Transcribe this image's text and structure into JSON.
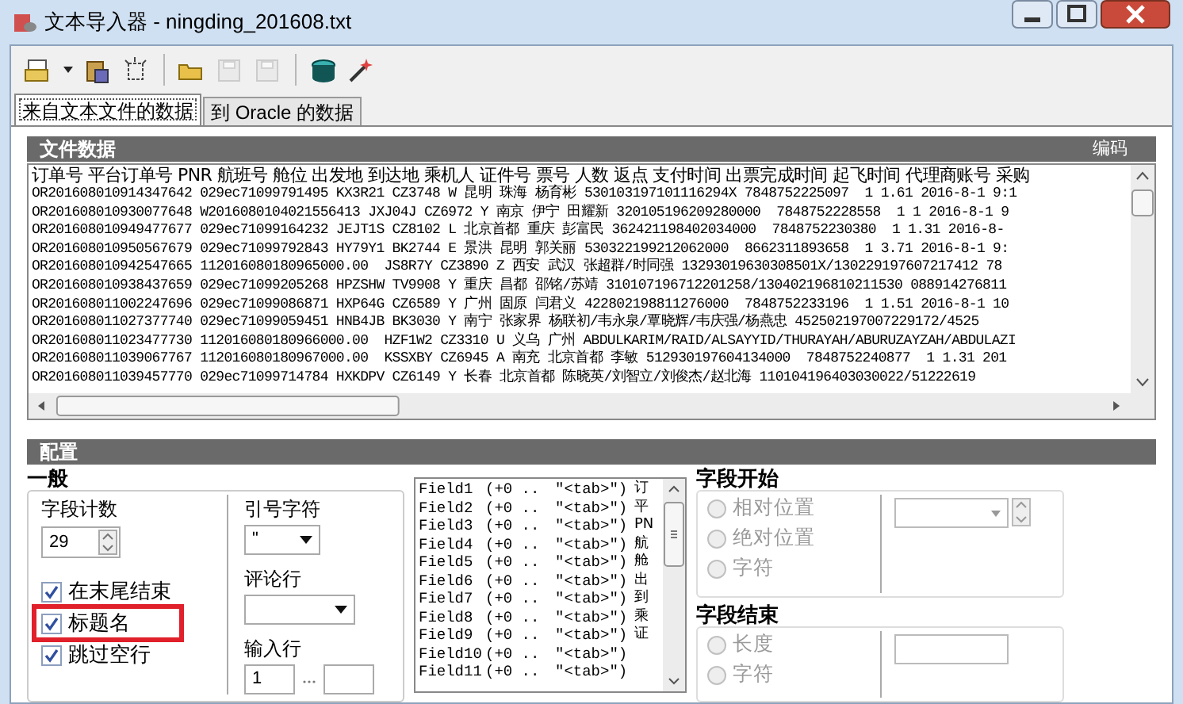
{
  "window": {
    "title": "文本导入器 - ningding_201608.txt"
  },
  "toolbar": [
    {
      "kind": "new",
      "disabled": false
    },
    {
      "kind": "caret",
      "disabled": false
    },
    {
      "kind": "paste",
      "disabled": false
    },
    {
      "kind": "dashed",
      "disabled": false
    },
    {
      "kind": "open",
      "disabled": false
    },
    {
      "kind": "save",
      "disabled": true
    },
    {
      "kind": "saveas",
      "disabled": true
    },
    {
      "kind": "database",
      "disabled": false
    },
    {
      "kind": "wand",
      "disabled": false
    }
  ],
  "tabs": [
    {
      "label": "来自文本文件的数据",
      "selected": true
    },
    {
      "label": "到 Oracle 的数据",
      "selected": false
    }
  ],
  "file_data": {
    "title": "文件数据",
    "encoding_label": "编码",
    "rows": [
      "订单号 平台订单号 PNR 航班号 舱位 出发地 到达地 乘机人 证件号 票号 人数 返点 支付时间 出票完成时间 起飞时间 代理商账号 采购",
      "OR201608010914347642 029ec71099791495 KX3R21 CZ3748 W 昆明 珠海 杨育彬 530103197101116294X 7848752225097  1 1.61 2016-8-1 9:1",
      "OR201608010930077648 W2016080104021556413 JXJ04J CZ6972 Y 南京 伊宁 田耀新 320105196209280000  7848752228558  1 1 2016-8-1 9",
      "OR201608010949477677 029ec71099164232 JEJT1S CZ8102 L 北京首都 重庆 彭富民 362421198402034000  7848752230380  1 1.31 2016-8-",
      "OR201608010950567679 029ec71099792843 HY79Y1 BK2744 E 景洪 昆明 郭关丽 530322199212062000  8662311893658  1 3.71 2016-8-1 9:",
      "OR201608010942547665 112016080180965000.00  JS8R7Y CZ3890 Z 西安 武汉 张超群/时同强 13293019630308501X/130229197607217412 78",
      "OR201608010938437659 029ec71099205268 HPZSHW TV9908 Y 重庆 昌都 邵铭/苏靖 310107196712201258/130402196810211530 088914276811",
      "OR201608011002247696 029ec71099086871 HXP64G CZ6589 Y 广州 固原 闫君义 422802198811276000  7848752233196  1 1.51 2016-8-1 10",
      "OR201608011027377740 029ec71099059451 HNB4JB BK3030 Y 南宁 张家界 杨联初/韦永泉/覃晓辉/韦庆强/杨燕忠 452502197007229172/4525",
      "OR201608011023477730 112016080180966000.00  HZF1W2 CZ3310 U 义乌 广州 ABDULKARIM/RAID/ALSAYYID/THURAYAH/ABURUZAYZAH/ABDULAZI",
      "OR201608011039067767 112016080180967000.00  KSSXBY CZ6945 A 南充 北京首都 李敏 512930197604134000  7848752240877  1 1.31 201",
      "OR201608011039457770 029ec71099714784 HXKDPV CZ6149 Y 长春 北京首都 陈晓英/刘智立/刘俊杰/赵北海 110104196403030022/51222619"
    ]
  },
  "config": {
    "title": "配置",
    "general": {
      "title": "一般",
      "field_count_label": "字段计数",
      "field_count": "29",
      "checkboxes": [
        {
          "label": "在末尾结束",
          "checked": true,
          "highlighted": false
        },
        {
          "label": "标题名",
          "checked": true,
          "highlighted": true
        },
        {
          "label": "跳过空行",
          "checked": true,
          "highlighted": false
        }
      ],
      "quote_label": "引号字符",
      "quote_value": "\"",
      "comment_label": "评论行",
      "input_rows_label": "输入行",
      "input_rows_from": "1"
    },
    "fields": [
      {
        "name": "Field1",
        "range": "(+0 ..",
        "delimiter": "\"<tab>\")",
        "column_3": "订"
      },
      {
        "name": "Field2",
        "range": "(+0 ..",
        "delimiter": "\"<tab>\")",
        "column_3": "平"
      },
      {
        "name": "Field3",
        "range": "(+0 ..",
        "delimiter": "\"<tab>\")",
        "column_3": "PN"
      },
      {
        "name": "Field4",
        "range": "(+0 ..",
        "delimiter": "\"<tab>\")",
        "column_3": "航"
      },
      {
        "name": "Field5",
        "range": "(+0 ..",
        "delimiter": "\"<tab>\")",
        "column_3": "舱"
      },
      {
        "name": "Field6",
        "range": "(+0 ..",
        "delimiter": "\"<tab>\")",
        "column_3": "出"
      },
      {
        "name": "Field7",
        "range": "(+0 ..",
        "delimiter": "\"<tab>\")",
        "column_3": "到"
      },
      {
        "name": "Field8",
        "range": "(+0 ..",
        "delimiter": "\"<tab>\")",
        "column_3": "乘"
      },
      {
        "name": "Field9",
        "range": "(+0 ..",
        "delimiter": "\"<tab>\")",
        "column_3": "证"
      },
      {
        "name": "Field10",
        "range": "(+0 ..",
        "delimiter": "\"<tab>\")"
      },
      {
        "name": "Field11",
        "range": "(+0 ..",
        "delimiter": "\"<tab>\")"
      }
    ],
    "field_start": {
      "title": "字段开始",
      "options": [
        {
          "label": "相对位置",
          "selected": false
        },
        {
          "label": "绝对位置",
          "selected": false
        },
        {
          "label": "字符",
          "selected": false
        }
      ]
    },
    "field_end": {
      "title": "字段结束",
      "options": [
        {
          "label": "长度",
          "selected": false
        },
        {
          "label": "字符",
          "selected": false
        }
      ]
    }
  }
}
